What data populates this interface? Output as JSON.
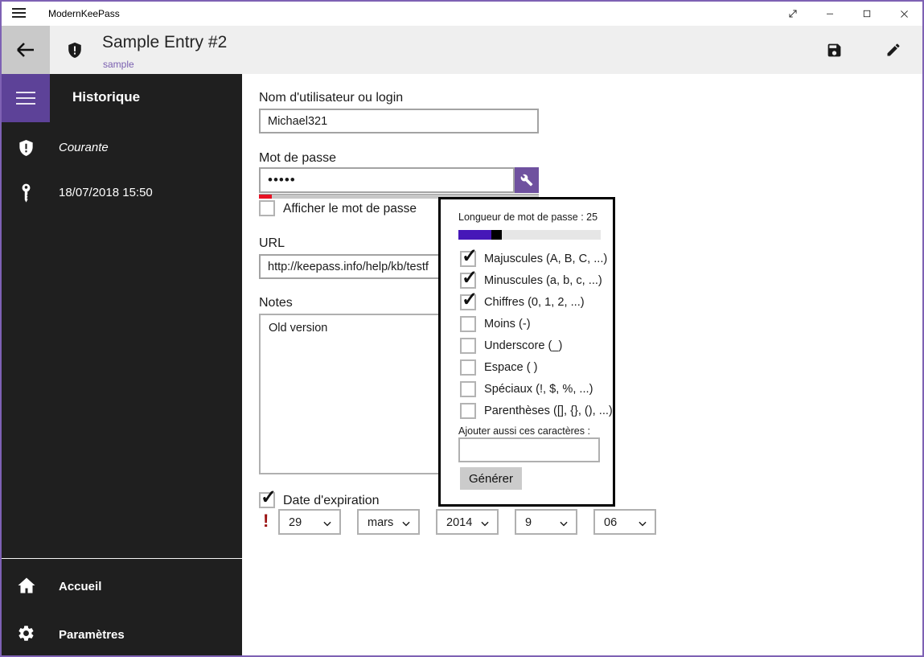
{
  "titlebar": {
    "app_title": "ModernKeePass"
  },
  "header": {
    "entry_title": "Sample Entry #2",
    "entry_subtitle": "sample"
  },
  "sidebar": {
    "heading": "Historique",
    "items": [
      {
        "icon": "shield-icon",
        "label": "Courante"
      },
      {
        "icon": "key-icon",
        "label": "18/07/2018 15:50"
      }
    ],
    "footer_items": [
      {
        "icon": "home-icon",
        "label": "Accueil"
      },
      {
        "icon": "gear-icon",
        "label": "Paramètres"
      }
    ]
  },
  "form": {
    "username_label": "Nom d'utilisateur ou login",
    "username_value": "Michael321",
    "password_label": "Mot de passe",
    "password_value": "•••••",
    "password_strength_percent": 4.5,
    "show_password_label": "Afficher le mot de passe",
    "url_label": "URL",
    "url_value": "http://keepass.info/help/kb/testf",
    "notes_label": "Notes",
    "notes_value": "Old version",
    "expiration_label": "Date d'expiration",
    "expiration_checked": true,
    "expiration_warning": "!",
    "date_parts": [
      "29",
      "mars",
      "2014",
      "9",
      "06"
    ]
  },
  "generator": {
    "length_label": "Longueur de mot de passe :",
    "length_value": "25",
    "slider_fill_percent": 23,
    "options": [
      {
        "label": "Majuscules (A, B, C, ...)",
        "checked": true
      },
      {
        "label": "Minuscules (a, b, c, ...)",
        "checked": true
      },
      {
        "label": "Chiffres (0, 1, 2, ...)",
        "checked": true
      },
      {
        "label": "Moins (-)",
        "checked": false
      },
      {
        "label": "Underscore (_)",
        "checked": false
      },
      {
        "label": "Espace ( )",
        "checked": false
      },
      {
        "label": "Spéciaux (!, $, %, ...)",
        "checked": false
      },
      {
        "label": "Parenthèses ([], {}, (), ...)",
        "checked": false
      }
    ],
    "custom_chars_label": "Ajouter aussi ces caractères :",
    "custom_chars_value": "",
    "generate_button": "Générer"
  },
  "icons": {
    "check": "✓"
  },
  "colors": {
    "accent_purple": "#5d4298",
    "wrench_button_purple": "#6f519f",
    "slider_purple": "#4617b8",
    "link_purple": "#7a5fb0",
    "strength_red": "#e81123",
    "warning_red": "#9b1212",
    "window_border_purple": "#7e61b4",
    "sidebar_bg": "#1f1f1f",
    "header_bg": "#efefef"
  }
}
